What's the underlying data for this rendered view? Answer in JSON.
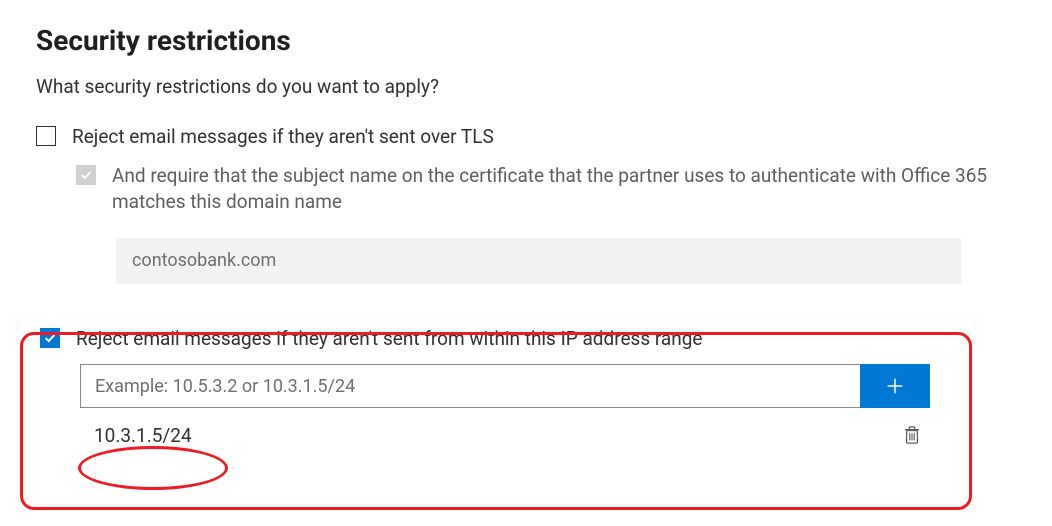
{
  "title": "Security restrictions",
  "subhead": "What security restrictions do you want to apply?",
  "tls": {
    "label": "Reject email messages if they aren't sent over TLS",
    "checked": false,
    "require_cert_label": "And require that the subject name on the certificate that the partner uses to authenticate with Office 365 matches this domain name",
    "domain_value": "contosobank.com"
  },
  "ip": {
    "label": "Reject email messages if they aren't sent from within this IP address range",
    "checked": true,
    "input_placeholder": "Example: 10.5.3.2 or 10.3.1.5/24",
    "items": [
      {
        "value": "10.3.1.5/24"
      }
    ]
  }
}
